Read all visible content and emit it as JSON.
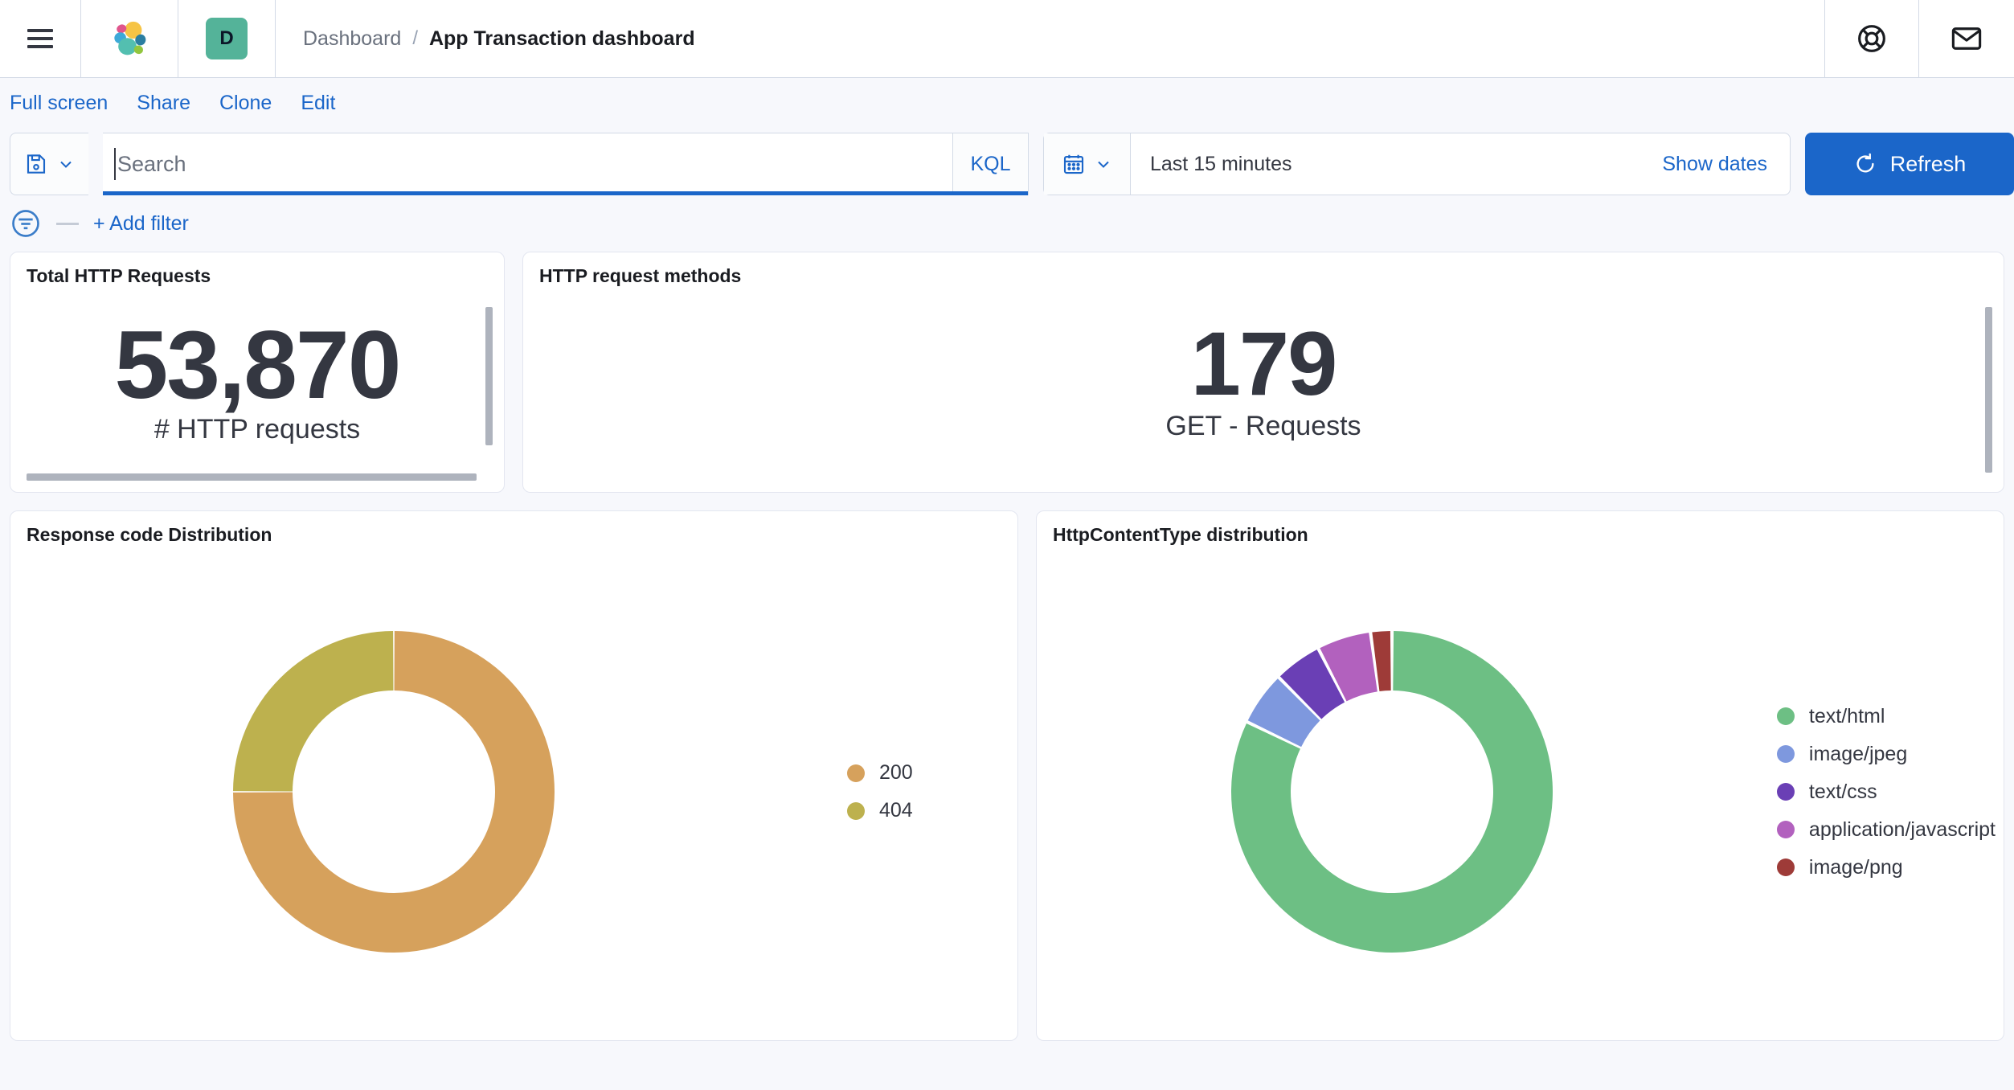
{
  "header": {
    "menu_icon": "hamburger-menu-icon",
    "logo_icon": "elastic-logo-icon",
    "space_badge": "D",
    "breadcrumbs": [
      {
        "label": "Dashboard",
        "current": false
      },
      {
        "label": "App Transaction dashboard",
        "current": true
      }
    ],
    "separator": "/",
    "help_icon": "lifebuoy-help-icon",
    "mail_icon": "envelope-mail-icon"
  },
  "navlinks": [
    {
      "label": "Full screen"
    },
    {
      "label": "Share"
    },
    {
      "label": "Clone"
    },
    {
      "label": "Edit"
    }
  ],
  "query_bar": {
    "saved_query_icon": "save-disk-icon",
    "saved_query_chevron": "chevron-down-icon",
    "search_value": "",
    "search_placeholder": "Search",
    "language": "KQL",
    "calendar_icon": "calendar-icon",
    "calendar_chevron": "chevron-down-icon",
    "date_range": "Last 15 minutes",
    "show_dates": "Show dates",
    "refresh_label": "Refresh",
    "refresh_icon": "refresh-circle-arrow-icon"
  },
  "filter_bar": {
    "filter_icon": "filter-funnel-icon",
    "add_filter": "+ Add filter"
  },
  "panels": {
    "total_http_requests": {
      "title": "Total HTTP Requests",
      "value": "53,870",
      "label": "# HTTP requests"
    },
    "http_request_methods": {
      "title": "HTTP request methods",
      "value": "179",
      "label": "GET - Requests"
    },
    "response_code_distribution": {
      "title": "Response code Distribution"
    },
    "http_content_type_distribution": {
      "title": "HttpContentType distribution"
    }
  },
  "chart_data": [
    {
      "type": "pie",
      "title": "Response code Distribution",
      "subtype": "donut",
      "legend_position": "right",
      "categories": [
        "200",
        "404"
      ],
      "values": [
        75,
        25
      ],
      "colors": [
        "#D6A15C",
        "#BDB14E"
      ],
      "start_angle": 0,
      "direction": "clockwise"
    },
    {
      "type": "pie",
      "title": "HttpContentType distribution",
      "subtype": "donut",
      "legend_position": "right",
      "categories": [
        "text/html",
        "image/jpeg",
        "text/css",
        "application/javascript",
        "image/png"
      ],
      "values": [
        84.7,
        5.6,
        5.0,
        5.6,
        2.2
      ],
      "colors": [
        "#6DBF84",
        "#7E98DE",
        "#6A3FB5",
        "#B261BE",
        "#9E3B38"
      ],
      "start_angle": 0,
      "direction": "clockwise"
    }
  ],
  "colors": {
    "accent_blue": "#1B66C9",
    "space_badge_bg": "#54B399",
    "text_dark": "#343741",
    "page_bg": "#F7F8FC"
  }
}
